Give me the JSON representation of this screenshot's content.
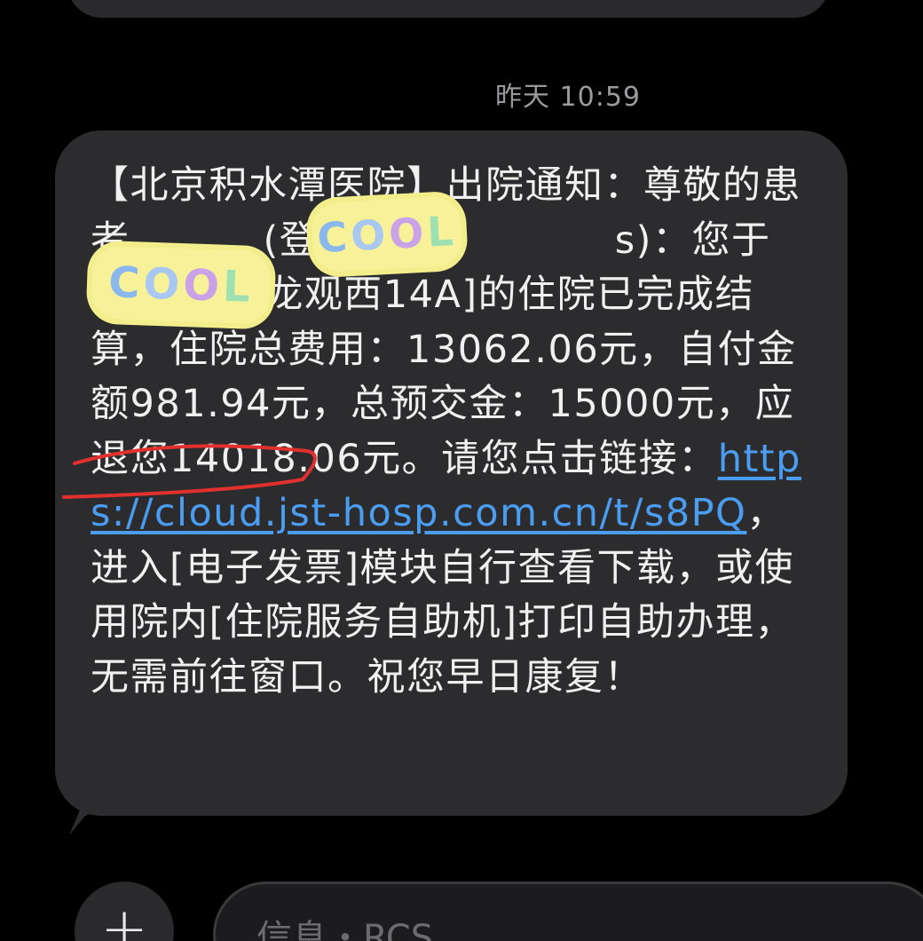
{
  "timestamp": "昨天 10:59",
  "message": {
    "part1": "【北京积水潭医院】出院通知：尊敬的患者",
    "part2": "(登记号：",
    "part3": "s)：您于[手外科回龙观西14A]的住院已完成结算，住院总费用：13062.06元，自付金额981.94元，总预交金：15000元，应退您14018.06元。请您点击链接：",
    "link": "https://cloud.jst-hosp.com.cn/t/s8PQ",
    "part4": "，进入[电子发票]模块自行查看下载，或使用院内[住院服务自助机]打印自助办理，无需前往窗口。祝您早日康复！"
  },
  "stickers": {
    "text": "COOL"
  },
  "colors": {
    "background": "#000000",
    "bubble": "#2c2c2e",
    "link": "#4a9df0",
    "annotation": "#e0312e"
  },
  "compose": {
    "plus_label": "+",
    "placeholder": "信息・RCS"
  }
}
